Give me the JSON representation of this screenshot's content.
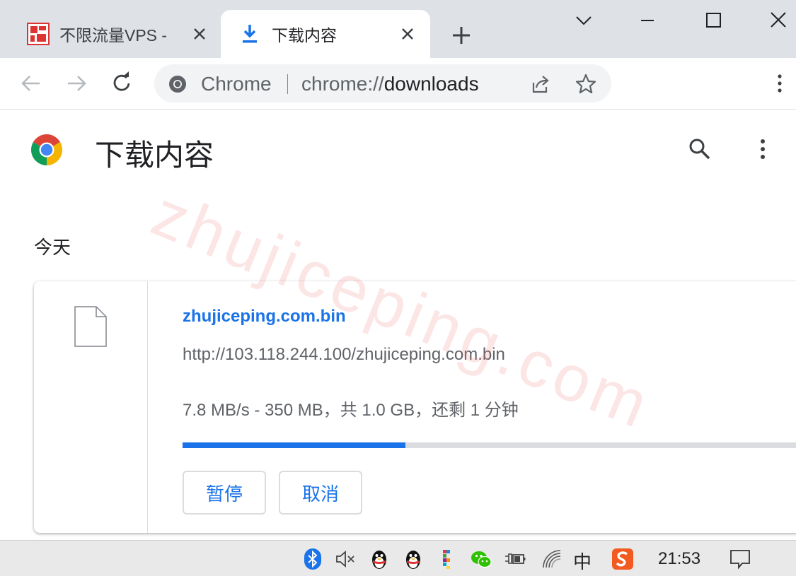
{
  "tabs": [
    {
      "title": "不限流量VPS - |",
      "icon": "site-favicon"
    },
    {
      "title": "下载内容",
      "icon": "download-icon",
      "active": true
    }
  ],
  "toolbar": {
    "omnibox": {
      "scheme_label": "Chrome",
      "url_prefix": "chrome://",
      "url_host": "downloads"
    }
  },
  "page": {
    "title": "下载内容",
    "date_heading": "今天"
  },
  "download": {
    "file_name": "zhujiceping.com.bin",
    "url": "http://103.118.244.100/zhujiceping.com.bin",
    "status": "7.8 MB/s - 350 MB，共 1.0 GB，还剩 1 分钟",
    "progress": 0.35,
    "pause_label": "暂停",
    "cancel_label": "取消"
  },
  "watermark": "zhujiceping.com",
  "taskbar": {
    "clock": "21:53",
    "ime_label": "中"
  },
  "colors": {
    "accent": "#1a73e8",
    "tabstrip": "#dee1e6",
    "omnibox": "#f1f3f4"
  }
}
